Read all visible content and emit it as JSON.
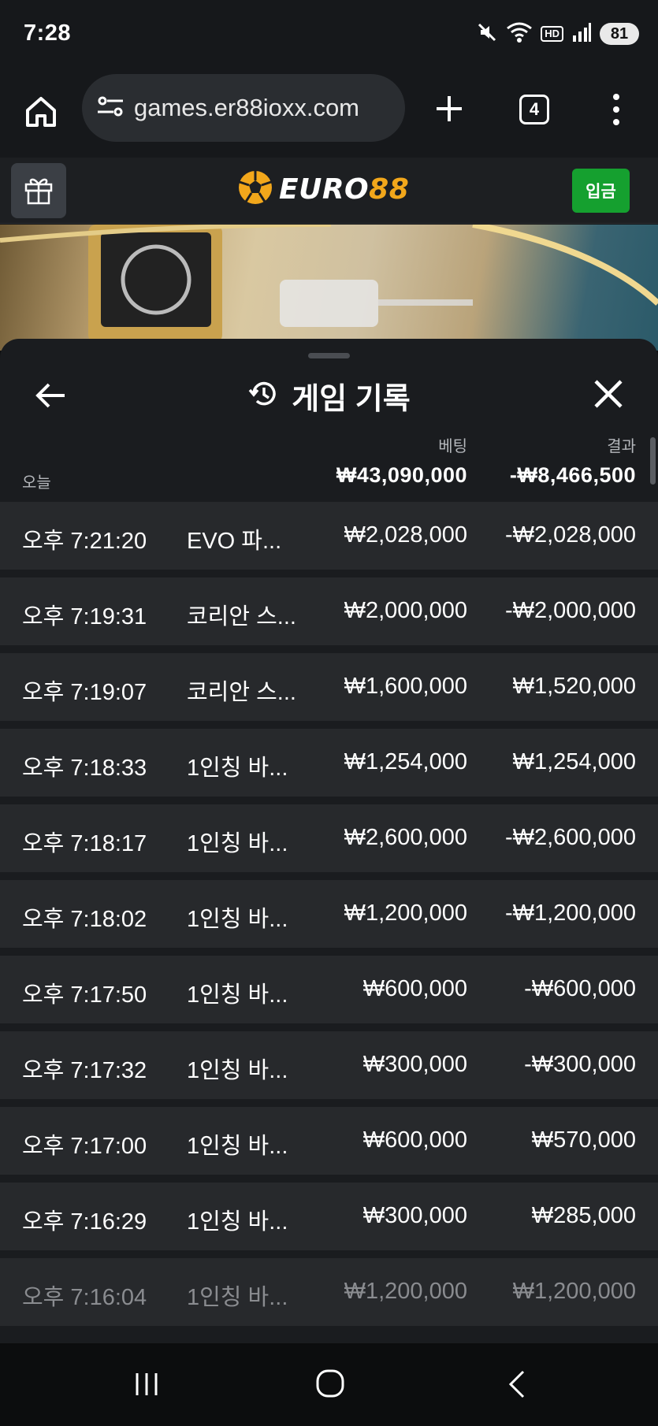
{
  "status": {
    "time": "7:28",
    "battery": "81",
    "hd": "HD",
    "icons": [
      "mute-icon",
      "wifi-icon",
      "hd-icon",
      "signal-icon",
      "battery-icon"
    ]
  },
  "browser": {
    "url": "games.er88ioxx.com",
    "tab_count": "4"
  },
  "site": {
    "logo_text": "EURO88",
    "deposit_label": "입금",
    "brand_color": "#f2a71b",
    "deposit_color": "#15a02f"
  },
  "sheet": {
    "title": "게임 기록",
    "summary": {
      "bet_label": "베팅",
      "result_label": "결과",
      "day_label": "오늘",
      "total_bet": "₩43,090,000",
      "total_result": "-₩8,466,500"
    },
    "rows": [
      {
        "time": "오후 7:21:20",
        "game": "EVO 파...",
        "bet": "₩2,028,000",
        "result": "-₩2,028,000"
      },
      {
        "time": "오후 7:19:31",
        "game": "코리안 스...",
        "bet": "₩2,000,000",
        "result": "-₩2,000,000"
      },
      {
        "time": "오후 7:19:07",
        "game": "코리안 스...",
        "bet": "₩1,600,000",
        "result": "₩1,520,000"
      },
      {
        "time": "오후 7:18:33",
        "game": "1인칭 바...",
        "bet": "₩1,254,000",
        "result": "₩1,254,000"
      },
      {
        "time": "오후 7:18:17",
        "game": "1인칭 바...",
        "bet": "₩2,600,000",
        "result": "-₩2,600,000"
      },
      {
        "time": "오후 7:18:02",
        "game": "1인칭 바...",
        "bet": "₩1,200,000",
        "result": "-₩1,200,000"
      },
      {
        "time": "오후 7:17:50",
        "game": "1인칭 바...",
        "bet": "₩600,000",
        "result": "-₩600,000"
      },
      {
        "time": "오후 7:17:32",
        "game": "1인칭 바...",
        "bet": "₩300,000",
        "result": "-₩300,000"
      },
      {
        "time": "오후 7:17:00",
        "game": "1인칭 바...",
        "bet": "₩600,000",
        "result": "₩570,000"
      },
      {
        "time": "오후 7:16:29",
        "game": "1인칭 바...",
        "bet": "₩300,000",
        "result": "₩285,000"
      },
      {
        "time": "오후 7:16:04",
        "game": "1인칭 바...",
        "bet": "₩1,200,000",
        "result": "₩1,200,000"
      }
    ]
  }
}
